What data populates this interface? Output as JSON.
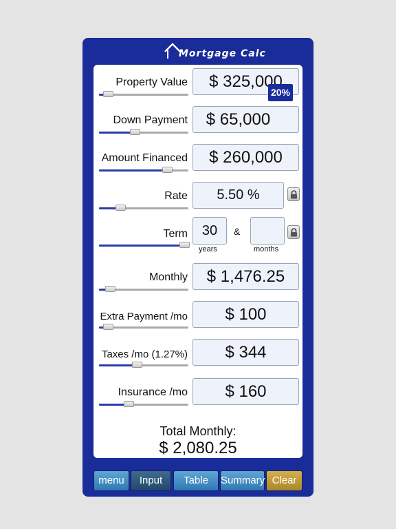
{
  "app": {
    "title": "Mortgage Calc"
  },
  "fields": {
    "property_value": {
      "label": "Property Value",
      "value": "$ 325,000",
      "slider": 0.1
    },
    "down_payment": {
      "label": "Down Payment",
      "value": "$ 65,000",
      "badge": "20%",
      "slider": 0.4
    },
    "amount_financed": {
      "label": "Amount Financed",
      "value": "$ 260,000",
      "slider": 0.76
    },
    "rate": {
      "label": "Rate",
      "value": "5.50 %",
      "slider": 0.24
    },
    "term": {
      "label": "Term",
      "years": "30",
      "months": "",
      "years_unit": "years",
      "months_unit": "months",
      "amp": "&",
      "slider": 0.95
    },
    "monthly": {
      "label": "Monthly",
      "value": "$ 1,476.25",
      "slider": 0.12
    },
    "extra_payment": {
      "label": "Extra Payment /mo",
      "value": "$ 100",
      "slider": 0.1
    },
    "taxes": {
      "label": "Taxes /mo (1.27%)",
      "value": "$ 344",
      "slider": 0.42
    },
    "insurance": {
      "label": "Insurance /mo",
      "value": "$ 160",
      "slider": 0.33
    }
  },
  "total": {
    "label": "Total Monthly:",
    "value": "$ 2,080.25"
  },
  "tabs": [
    {
      "label": "menu"
    },
    {
      "label": "Input",
      "active": true
    },
    {
      "label": "Table"
    },
    {
      "label": "Summary"
    },
    {
      "label": "Clear"
    }
  ],
  "colors": {
    "frame": "#1a2b9a",
    "tab": "#3b86c0",
    "clear": "#bf9a36"
  }
}
